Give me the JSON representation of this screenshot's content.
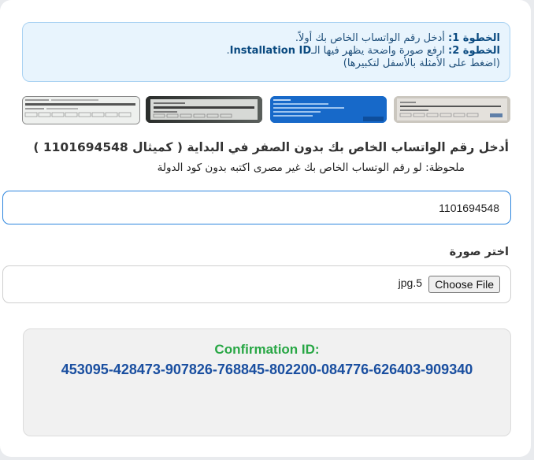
{
  "instructions": {
    "step1_label": "الخطوة 1:",
    "step1_text": " أدخل رقم الواتساب الخاص بك أولاً.",
    "step2_label": "الخطوة 2:",
    "step2_text_prefix": " ارفع صورة واضحة يظهر فيها الـ",
    "step2_text_bold": "Installation ID",
    "step2_text_suffix": ".",
    "hint": "(اضغط على الأمثلة بالأسفل لتكبيرها)"
  },
  "examples": [
    {
      "icon": "example-thumbnail-1"
    },
    {
      "icon": "example-thumbnail-2"
    },
    {
      "icon": "example-thumbnail-3"
    },
    {
      "icon": "example-thumbnail-4"
    }
  ],
  "phone": {
    "heading": "أدخل رقم الواتساب الخاص بك بدون الصفر في البداية ( كميثال 1101694548 )",
    "note": "ملحوظة: لو رقم الوتساب الخاص بك غير مصرى اكتبه بدون كود الدولة",
    "value": "1101694548"
  },
  "image_upload": {
    "label": "اختر صورة",
    "button_label": "Choose File",
    "file_name": "5.jpg"
  },
  "result": {
    "title": "Confirmation ID:",
    "value": "453095-428473-907826-768845-802200-084776-626403-909340",
    "title_color": "#28a745",
    "value_color": "#1a4fa0"
  },
  "colors": {
    "instructions_bg": "#e8f4fd",
    "input_focus_border": "#2e86de"
  }
}
